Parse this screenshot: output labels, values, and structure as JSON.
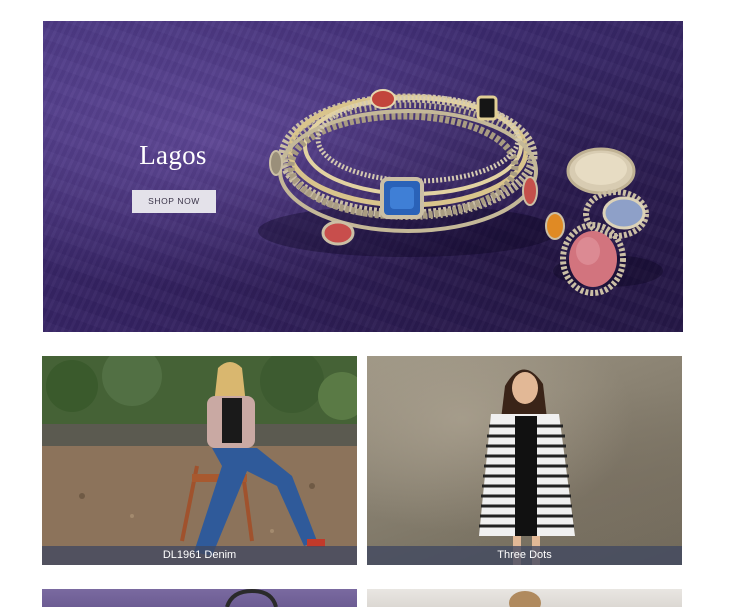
{
  "hero": {
    "brand_title": "Lagos",
    "shop_button_label": "SHOP NOW"
  },
  "tiles": [
    {
      "caption": "DL1961 Denim"
    },
    {
      "caption": "Three Dots"
    }
  ],
  "colors": {
    "hero_background": "#3e2c72",
    "caption_bar": "#404860",
    "button_background": "#e4e2ea"
  }
}
